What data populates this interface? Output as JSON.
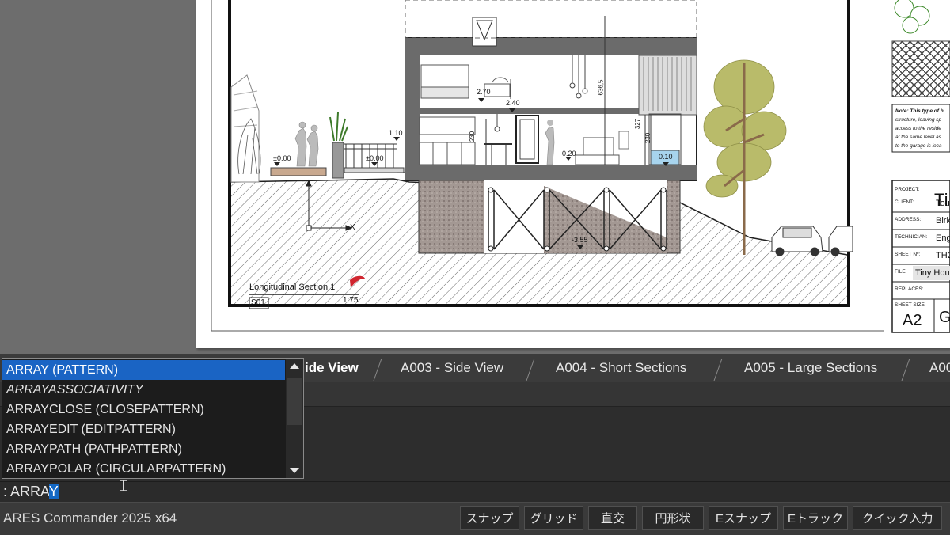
{
  "drawing": {
    "section_title": "Longitudinal Section 1",
    "sheet_ref": "S01",
    "scale": "1:75",
    "levels": [
      "±0.00",
      "±0.00",
      "1.10",
      "2.70",
      "2.40",
      "0.20",
      "0.10",
      "-3.55"
    ],
    "dimensions": [
      "636,5",
      "327",
      "230",
      "230"
    ],
    "ucs_label": "X"
  },
  "title_block": {
    "note": [
      "Note: This type of h",
      "structure, leaving sp",
      "access to the reside",
      "at the same level as",
      "to the garage is loca"
    ],
    "project_label": "PROJECT:",
    "project_value": "Ti",
    "client_label": "CLIENT:",
    "client_value": "Tou",
    "address_label": "ADDRESS:",
    "address_value": "Birk",
    "technician_label": "TECHNICIAN:",
    "technician_value": "Eng",
    "sheet_no_label": "SHEET Nº:",
    "sheet_no_value": "TH2",
    "file_label": "FILE:",
    "file_value": "Tiny Hou",
    "replaces_label": "REPLACES:",
    "sheet_size_label": "SHEET SIZE:",
    "sheet_size_value": "A2",
    "extra_value": "G"
  },
  "tabs": [
    {
      "label": "ide View"
    },
    {
      "label": "A003 - Side View"
    },
    {
      "label": "A004 - Short Sections"
    },
    {
      "label": "A005 - Large Sections"
    },
    {
      "label": "A00"
    }
  ],
  "autocomplete": {
    "items": [
      {
        "label": "ARRAY (PATTERN)"
      },
      {
        "label": "ARRAYASSOCIATIVITY"
      },
      {
        "label": "ARRAYCLOSE (CLOSEPATTERN)"
      },
      {
        "label": "ARRAYEDIT (EDITPATTERN)"
      },
      {
        "label": "ARRAYPATH (PATHPATTERN)"
      },
      {
        "label": "ARRAYPOLAR (CIRCULARPATTERN)"
      }
    ]
  },
  "command": {
    "prefix": ": ARRA",
    "selected": "Y"
  },
  "status": {
    "app_name": "ARES Commander 2025 x64",
    "buttons": {
      "snap": "スナップ",
      "grid": "グリッド",
      "ortho": "直交",
      "polar": "円形状",
      "esnap": "Eスナップ",
      "etrack": "Eトラック",
      "quick_input": "クイック入力"
    }
  },
  "colors": {
    "accent": "#1a64c4",
    "viewport_bg": "#6d6d6d",
    "panel_dark": "#2d2d2d",
    "status_bg": "#3a3a3a",
    "tree_foliage": "#b9bb6a",
    "water_blue": "#a7d4ee",
    "stone": "#9a8e88"
  }
}
